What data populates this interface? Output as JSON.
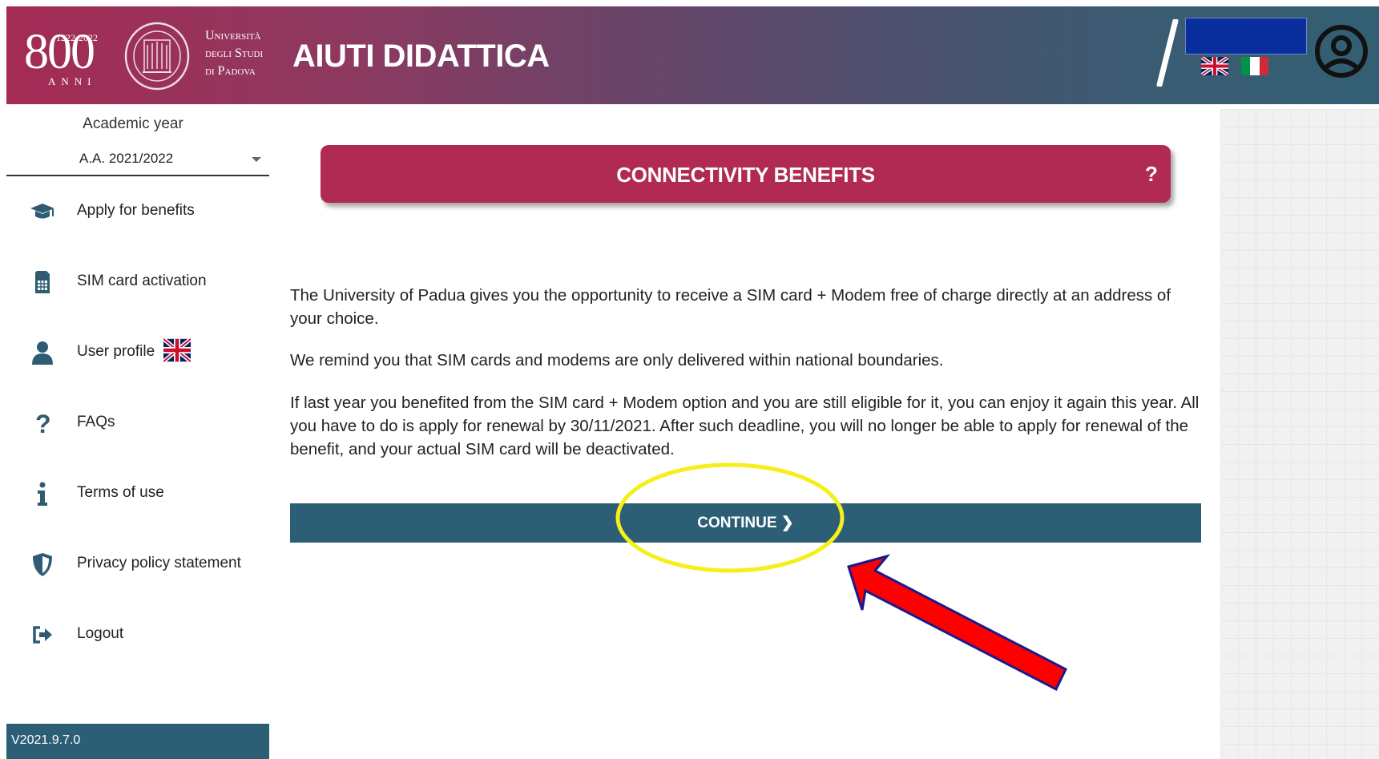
{
  "header": {
    "logo_years": "1222·2022",
    "logo_number": "800",
    "logo_anni": "ANNI",
    "university_line1": "Università",
    "university_line2": "degli Studi",
    "university_line3": "di Padova",
    "app_title": "AIUTI DIDATTICA",
    "slash": "/"
  },
  "sidebar": {
    "academic_year_label": "Academic year",
    "academic_year_value": "A.A. 2021/2022",
    "items": [
      {
        "label": "Apply for benefits",
        "icon": "graduation-cap-icon"
      },
      {
        "label": "SIM card activation",
        "icon": "sim-card-icon"
      },
      {
        "label": "User profile",
        "icon": "user-icon"
      },
      {
        "label": "FAQs",
        "icon": "question-icon"
      },
      {
        "label": "Terms of use",
        "icon": "info-icon"
      },
      {
        "label": "Privacy policy statement",
        "icon": "shield-icon"
      },
      {
        "label": "Logout",
        "icon": "logout-icon"
      }
    ],
    "version": "V2021.9.7.0"
  },
  "main": {
    "section_title": "CONNECTIVITY BENEFITS",
    "help_label": "?",
    "paragraphs": [
      "The University of Padua gives you the opportunity to receive a SIM card + Modem free of charge directly at an address of your choice.",
      "We remind you that SIM cards and modems are only delivered within national boundaries.",
      "If last year you benefited from the SIM card + Modem option and you are still eligible for it, you can enjoy it again this year. All you have to do is apply for renewal by 30/11/2021. After such deadline, you will no longer be able to apply for renewal of the benefit, and your actual SIM card will be deactivated."
    ],
    "continue_label": "CONTINUE ❯"
  },
  "colors": {
    "accent_red": "#b02a53",
    "primary_teal": "#2c5f76",
    "annotation_yellow": "#f5ef1c",
    "annotation_red": "#ff0000",
    "annotation_blue": "#082f9d"
  }
}
